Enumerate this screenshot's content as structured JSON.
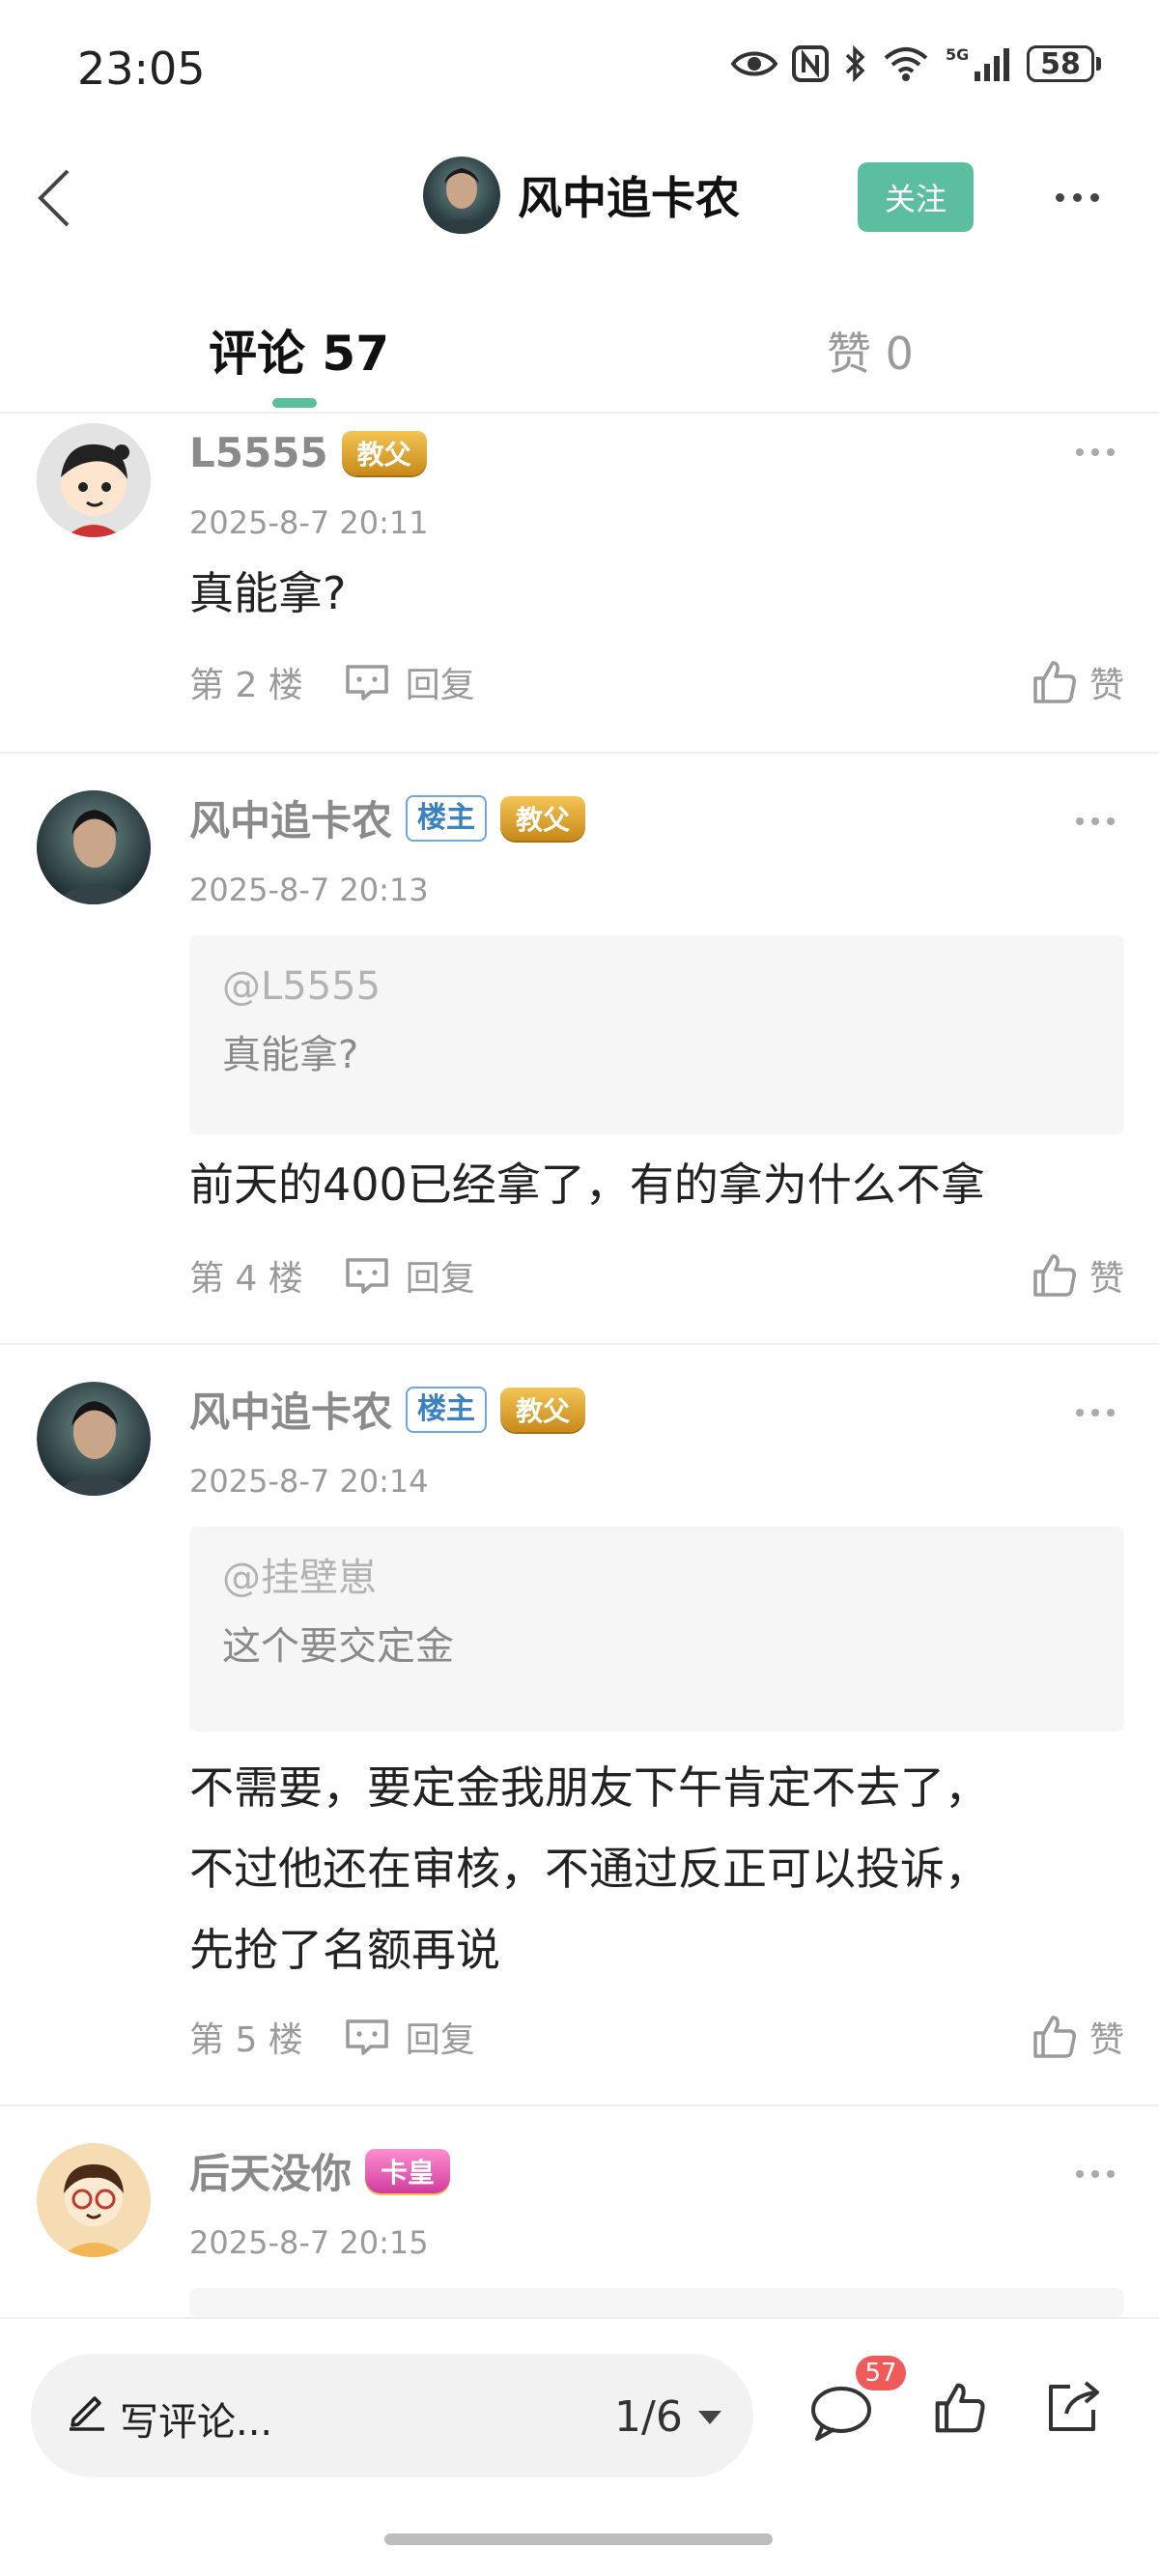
{
  "status_bar": {
    "time": "23:05",
    "battery": "58"
  },
  "header": {
    "title": "风中追卡农",
    "follow_label": "关注"
  },
  "tabs": [
    {
      "label": "评论 57",
      "active": true
    },
    {
      "label": "赞 0",
      "active": false
    }
  ],
  "comments": [
    {
      "name": "L5555",
      "badges": [
        "教父"
      ],
      "time": "2025-8-7 20:11",
      "text": "真能拿?",
      "floor": "第 2 楼",
      "reply_label": "回复",
      "like_label": "赞"
    },
    {
      "name": "风中追卡农",
      "owner_badge": "楼主",
      "badges": [
        "教父"
      ],
      "time": "2025-8-7 20:13",
      "quote": {
        "user": "@L5555",
        "text": "真能拿?"
      },
      "text": "前天的400已经拿了，有的拿为什么不拿",
      "floor": "第 4 楼",
      "reply_label": "回复",
      "like_label": "赞"
    },
    {
      "name": "风中追卡农",
      "owner_badge": "楼主",
      "badges": [
        "教父"
      ],
      "time": "2025-8-7 20:14",
      "quote": {
        "user": "@挂壁崽",
        "text": "这个要交定金"
      },
      "text_lines": [
        "不需要，要定金我朋友下午肯定不去了，",
        "不过他还在审核，不通过反正可以投诉，",
        "先抢了名额再说"
      ],
      "floor": "第 5 楼",
      "reply_label": "回复",
      "like_label": "赞"
    },
    {
      "name": "后天没你",
      "badges": [
        "卡皇"
      ],
      "time": "2025-8-7 20:15"
    }
  ],
  "bottom_bar": {
    "placeholder": "写评论...",
    "page": "1/6",
    "comment_count": "57"
  },
  "colors": {
    "accent": "#5bbf9f",
    "badge_red": "#f05a5a",
    "owner_blue": "#3b82c4"
  }
}
